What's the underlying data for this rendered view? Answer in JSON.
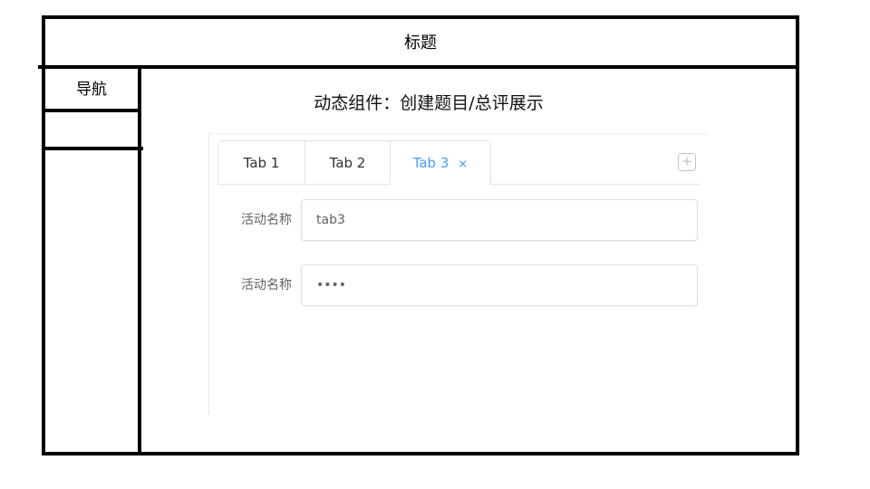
{
  "header": {
    "title": "标题"
  },
  "sidebar": {
    "nav_label": "导航"
  },
  "main": {
    "title": "动态组件：创建题目/总评展示",
    "tabs": [
      {
        "label": "Tab 1",
        "active": false
      },
      {
        "label": "Tab 2",
        "active": false
      },
      {
        "label": "Tab 3",
        "active": true,
        "close_icon": "close-icon"
      }
    ],
    "add_tab_icon": "plus-icon",
    "close_glyph": "×",
    "add_glyph": "+",
    "form": {
      "fields": [
        {
          "label": "活动名称",
          "value": "tab3",
          "type": "text"
        },
        {
          "label": "活动名称",
          "value": "1234",
          "type": "password"
        }
      ]
    }
  },
  "colors": {
    "active_tab": "#409eff",
    "border": "#dfe4ed",
    "label_text": "#606266"
  }
}
